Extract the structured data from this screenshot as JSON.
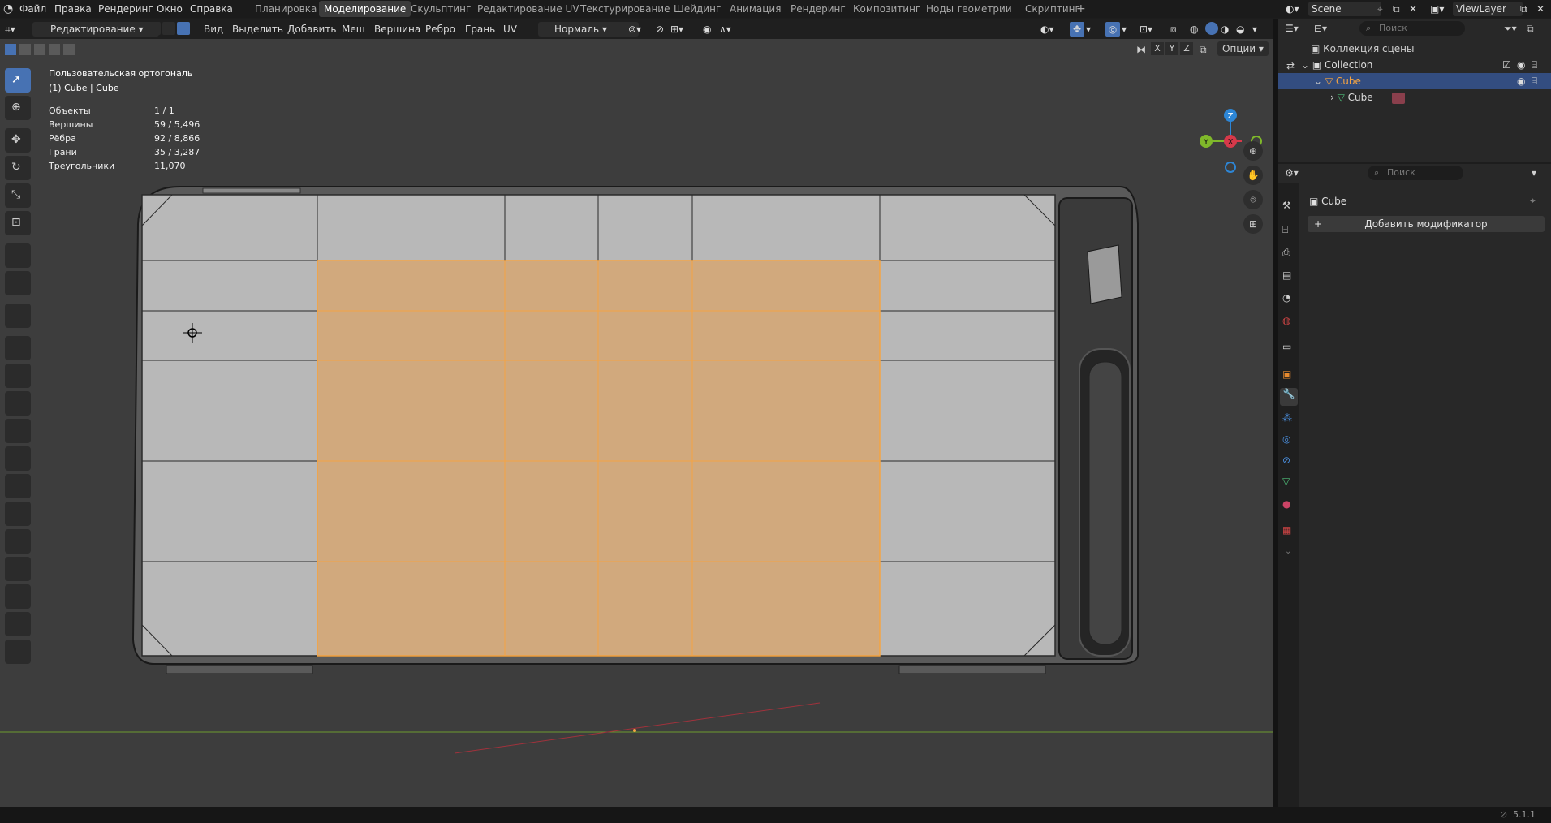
{
  "menu": {
    "items": [
      "Файл",
      "Правка",
      "Рендеринг",
      "Окно",
      "Справка"
    ]
  },
  "workspaces": {
    "tabs": [
      "Планировка",
      "Моделирование",
      "Скульптинг",
      "Редактирование UV",
      "Текстурирование",
      "Шейдинг",
      "Анимация",
      "Рендеринг",
      "Композитинг",
      "Ноды геометрии",
      "Скриптинг"
    ],
    "active": "Моделирование",
    "add": "+"
  },
  "scene": {
    "name": "Scene",
    "view_layer": "ViewLayer"
  },
  "header": {
    "mode": "Редактирование",
    "menus": [
      "Вид",
      "Выделить",
      "Добавить",
      "Меш",
      "Вершина",
      "Ребро",
      "Грань",
      "UV"
    ],
    "orientation": "Нормаль",
    "options": "Опции",
    "axes": [
      "X",
      "Y",
      "Z"
    ]
  },
  "viewport": {
    "view_name": "Пользовательская ортогональ",
    "object_line": "(1) Cube | Cube",
    "stats": [
      {
        "label": "Объекты",
        "value": "1 / 1"
      },
      {
        "label": "Вершины",
        "value": "59 / 5,496"
      },
      {
        "label": "Рёбра",
        "value": "92 / 8,866"
      },
      {
        "label": "Грани",
        "value": "35 / 3,287"
      },
      {
        "label": "Треугольники",
        "value": "11,070"
      }
    ],
    "gizmo": {
      "x": "X",
      "y": "Y",
      "z": "Z"
    },
    "colors": {
      "selection": "#f5a442",
      "x_axis": "#d6394a",
      "y_axis": "#7fb82a",
      "z_axis": "#2d86d6"
    }
  },
  "outliner": {
    "search_placeholder": "Поиск",
    "root": "Коллекция сцены",
    "collection": "Collection",
    "object": "Cube",
    "mesh": "Cube"
  },
  "properties": {
    "search_placeholder": "Поиск",
    "object_name": "Cube",
    "add_modifier": "Добавить модификатор"
  },
  "status": {
    "version": "5.1.1"
  }
}
